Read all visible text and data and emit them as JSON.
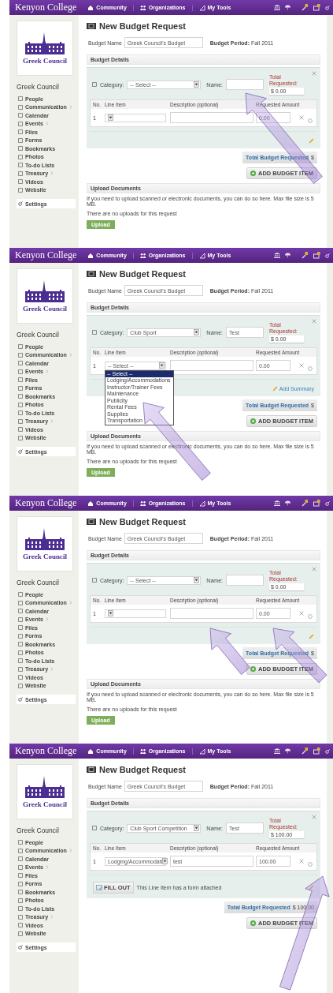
{
  "panels": [
    {
      "header": {
        "brand": "Kenyon College",
        "nav": [
          "Community",
          "Organizations",
          "My Tools"
        ]
      },
      "sidebar": {
        "logo_text": "Greek Council",
        "org_name": "Greek Council",
        "items": [
          {
            "label": "People",
            "submenu": false
          },
          {
            "label": "Communication",
            "submenu": true
          },
          {
            "label": "Calendar",
            "submenu": false
          },
          {
            "label": "Events",
            "submenu": true
          },
          {
            "label": "Files",
            "submenu": false
          },
          {
            "label": "Forms",
            "submenu": false
          },
          {
            "label": "Bookmarks",
            "submenu": false
          },
          {
            "label": "Photos",
            "submenu": false
          },
          {
            "label": "To-do Lists",
            "submenu": false
          },
          {
            "label": "Treasury",
            "submenu": true
          },
          {
            "label": "Videos",
            "submenu": false
          },
          {
            "label": "Website",
            "submenu": false
          }
        ],
        "settings": "Settings"
      },
      "title": "New Budget Request",
      "budget_name_label": "Budget Name",
      "budget_name": "Greek Council's Budget",
      "budget_period": "**Budget Period:** Fall 2011",
      "details_heading": "Budget Details",
      "item": {
        "category_label": "Category:",
        "category": "-- Select --",
        "name_label": "Name:",
        "total_label": "Total Requested:",
        "total": "$ 0.00",
        "columns": [
          "No.",
          "Line Item",
          "Description (optional)",
          "Requested Amount"
        ],
        "row": {
          "no": "1",
          "amount": "0.00"
        }
      },
      "total_budget_label": "Total Budget Requested",
      "total_budget_value": "$",
      "add_item": "ADD BUDGET ITEM",
      "upload": {
        "heading": "Upload Documents",
        "info": "If you need to upload scanned or electronic documents, you can do so here. Max file size is 5 MB.",
        "empty": "There are no uploads for this request",
        "button": "Upload"
      },
      "arrows": [
        {
          "kind": "name_field"
        }
      ]
    },
    {
      "header": {
        "brand": "Kenyon College",
        "nav": [
          "Community",
          "Organizations",
          "My Tools"
        ]
      },
      "sidebar": {
        "logo_text": "Greek Council",
        "org_name": "Greek Council",
        "items": [
          {
            "label": "People",
            "submenu": false
          },
          {
            "label": "Communication",
            "submenu": true
          },
          {
            "label": "Calendar",
            "submenu": false
          },
          {
            "label": "Events",
            "submenu": true
          },
          {
            "label": "Files",
            "submenu": false
          },
          {
            "label": "Forms",
            "submenu": false
          },
          {
            "label": "Bookmarks",
            "submenu": false
          },
          {
            "label": "Photos",
            "submenu": false
          },
          {
            "label": "To-do Lists",
            "submenu": false
          },
          {
            "label": "Treasury",
            "submenu": true
          },
          {
            "label": "Videos",
            "submenu": false
          },
          {
            "label": "Website",
            "submenu": false
          }
        ],
        "settings": "Settings"
      },
      "title": "New Budget Request",
      "budget_name_label": "Budget Name",
      "budget_name": "Greek Council's Budget",
      "budget_period": "**Budget Period:** Fall 2011",
      "details_heading": "Budget Details",
      "item": {
        "category_label": "Category:",
        "category": "Club Sport",
        "name_label": "Name:",
        "name": "Test",
        "total_label": "Total Requested:",
        "total": "$ 0.00",
        "columns": [
          "No.",
          "Line Item",
          "Description (optional)",
          "Requested Amount"
        ],
        "row": {
          "no": "1",
          "line_item": "-- Select --",
          "amount": "0.00",
          "options": [
            {
              "label": "-- Select --",
              "selected": true
            },
            {
              "label": "Lodging/Accommodations",
              "selected": false
            },
            {
              "label": "Instructor/Trainer Fees",
              "selected": false
            },
            {
              "label": "Maintenance",
              "selected": false
            },
            {
              "label": "Publicity",
              "selected": false
            },
            {
              "label": "Rental Fees",
              "selected": false
            },
            {
              "label": "Supplies",
              "selected": false
            },
            {
              "label": "Transportation",
              "selected": false
            }
          ]
        },
        "add_summary": "Add Summary"
      },
      "total_budget_label": "Total Budget Requested",
      "total_budget_value": "$",
      "add_item": "ADD BUDGET ITEM",
      "upload": {
        "heading": "Upload Documents",
        "info": "If you need to upload scanned or electronic documents, you can do so here. Max file size is 5 MB.",
        "empty": "There are no uploads for this request",
        "button": "Upload"
      },
      "arrows": [
        {
          "kind": "line_item_options"
        }
      ]
    },
    {
      "header": {
        "brand": "Kenyon College",
        "nav": [
          "Community",
          "Organizations",
          "My Tools"
        ]
      },
      "sidebar": {
        "logo_text": "Greek Council",
        "org_name": "Greek Council",
        "items": [
          {
            "label": "People",
            "submenu": false
          },
          {
            "label": "Communication",
            "submenu": true
          },
          {
            "label": "Calendar",
            "submenu": false
          },
          {
            "label": "Events",
            "submenu": true
          },
          {
            "label": "Files",
            "submenu": false
          },
          {
            "label": "Forms",
            "submenu": false
          },
          {
            "label": "Bookmarks",
            "submenu": false
          },
          {
            "label": "Photos",
            "submenu": false
          },
          {
            "label": "To-do Lists",
            "submenu": false
          },
          {
            "label": "Treasury",
            "submenu": true
          },
          {
            "label": "Videos",
            "submenu": false
          },
          {
            "label": "Website",
            "submenu": false
          }
        ],
        "settings": "Settings"
      },
      "title": "New Budget Request",
      "budget_name_label": "Budget Name",
      "budget_name": "Greek Council's Budget",
      "budget_period": "**Budget Period:** Fall 2011",
      "details_heading": "Budget Details",
      "item": {
        "category_label": "Category:",
        "category": "-- Select --",
        "name_label": "Name:",
        "total_label": "Total Requested:",
        "total": "$ 0.00",
        "columns": [
          "No.",
          "Line Item",
          "Description (optional)",
          "Requested Amount"
        ],
        "row": {
          "no": "1",
          "amount": "0.00"
        }
      },
      "total_budget_label": "Total Budget Requested",
      "total_budget_value": "$",
      "add_item": "ADD BUDGET ITEM",
      "upload": {
        "heading": "Upload Documents",
        "info": "If you need to upload scanned or electronic documents, you can do so here. Max file size is 5 MB.",
        "empty": "There are no uploads for this request",
        "button": "Upload"
      },
      "arrows": [
        {
          "kind": "description_field"
        },
        {
          "kind": "amount_field"
        }
      ]
    },
    {
      "header": {
        "brand": "Kenyon College",
        "nav": [
          "Community",
          "Organizations",
          "My Tools"
        ]
      },
      "sidebar": {
        "logo_text": "Greek Council",
        "org_name": "Greek Council",
        "items": [
          {
            "label": "People",
            "submenu": false
          },
          {
            "label": "Communication",
            "submenu": true
          },
          {
            "label": "Calendar",
            "submenu": false
          },
          {
            "label": "Events",
            "submenu": true
          },
          {
            "label": "Files",
            "submenu": false
          },
          {
            "label": "Forms",
            "submenu": false
          },
          {
            "label": "Bookmarks",
            "submenu": false
          },
          {
            "label": "Photos",
            "submenu": false
          },
          {
            "label": "To-do Lists",
            "submenu": false
          },
          {
            "label": "Treasury",
            "submenu": true
          },
          {
            "label": "Videos",
            "submenu": false
          },
          {
            "label": "Website",
            "submenu": false
          }
        ],
        "settings": "Settings"
      },
      "title": "New Budget Request",
      "budget_name_label": "Budget Name",
      "budget_name": "Greek Council's Budget",
      "budget_period": "**Budget Period:** Fall 2011",
      "details_heading": "Budget Details",
      "item": {
        "category_label": "Category:",
        "category": "Club Sport Competition",
        "name_label": "Name:",
        "name": "Test",
        "total_label": "Total Requested:",
        "total": "$ 100.00",
        "columns": [
          "No.",
          "Line Item",
          "Description (optional)",
          "Requested Amount"
        ],
        "row": {
          "no": "1",
          "line_item": "Lodging/Accommodati",
          "description": "test",
          "amount": "100.00"
        },
        "fill_out": {
          "button": "FILL OUT",
          "note": "This Line Item has a form attached"
        }
      },
      "total_budget_label": "Total Budget Requested",
      "total_budget_value": "$ 100.00",
      "add_item": "ADD BUDGET ITEM",
      "arrows": [
        {
          "kind": "row_settings"
        }
      ]
    }
  ]
}
